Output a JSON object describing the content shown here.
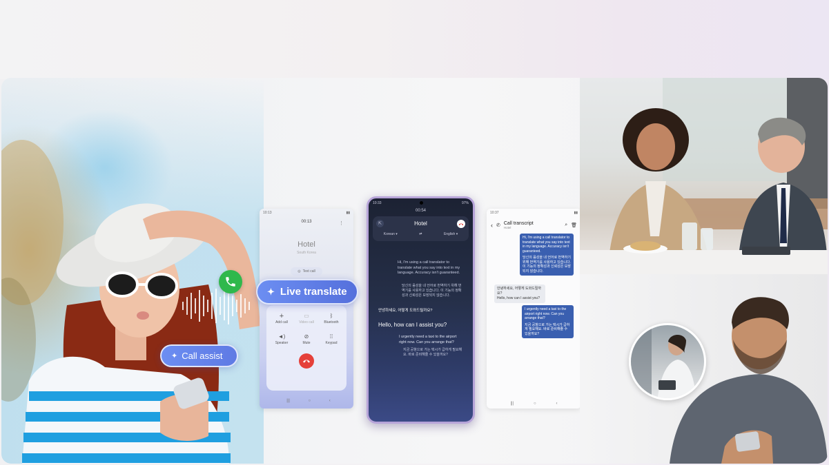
{
  "badges": {
    "live_translate": "Live translate",
    "call_assist": "Call assist"
  },
  "left_screen": {
    "status_time": "10:13",
    "timer": "00:13",
    "contact": "Hotel",
    "location": "South Korea",
    "text_call": "Text call",
    "controls": [
      {
        "label": "Add call",
        "icon": "plus-icon"
      },
      {
        "label": "Video call",
        "icon": "video-icon"
      },
      {
        "label": "Bluetooth",
        "icon": "bluetooth-icon"
      },
      {
        "label": "Speaker",
        "icon": "speaker-icon"
      },
      {
        "label": "Mute",
        "icon": "mute-icon"
      },
      {
        "label": "Keypad",
        "icon": "keypad-icon"
      }
    ]
  },
  "center_phone": {
    "status_time": "10:33",
    "status_battery": "97%",
    "timer": "00:54",
    "contact": "Hotel",
    "source_language": "Korean",
    "target_language": "English",
    "message_1": "Hi, I'm using a call translator to translate what you say into text in my language. Accuracy isn't guaranteed.",
    "message_1_korean": "당신의 음성을 내 언어로 번역하기 위해 번역기를 사용하고 있습니다. 이 기능의 정확성과 신뢰성은 보장되지 않습니다.",
    "message_2_korean": "안녕하세요, 어떻게 도와드릴까요?",
    "message_2": "Hello, how can I assist you?",
    "message_3": "I urgently need a taxi to the airport right now. Can you arrange that?",
    "message_3_korean": "지금 공항으로 가는 택시가 급하게 필요해요. 바로 준비해줄 수 있을까요?"
  },
  "right_screen": {
    "status_time": "10:37",
    "title": "Call transcript",
    "subtitle": "Hotel",
    "message_1": "Hi, I'm using a call translator to translate what you say into text in my language. Accuracy isn't guaranteed.",
    "message_1_korean": "당신의 음성을 내 언어로 번역하기 위해 번역기를 사용하고 있습니다. 이 기능의 정확성과 신뢰성은 보장되지 않습니다.",
    "message_2_korean": "안녕하세요, 어떻게 도와드릴까요?",
    "message_2": "Hello, how can I assist you?",
    "message_3": "I urgently need a taxi to the airport right now. Can you arrange that?",
    "message_3_korean": "지금 공항으로 가는 택시가 급하게 필요해요. 바로 준비해줄 수 있을까요?"
  },
  "colors": {
    "accent_blue": "#4f6fe0",
    "end_call_red": "#e5403a",
    "phone_frame": "#b7a4d9",
    "bubble_blue": "#3a5fb0"
  }
}
